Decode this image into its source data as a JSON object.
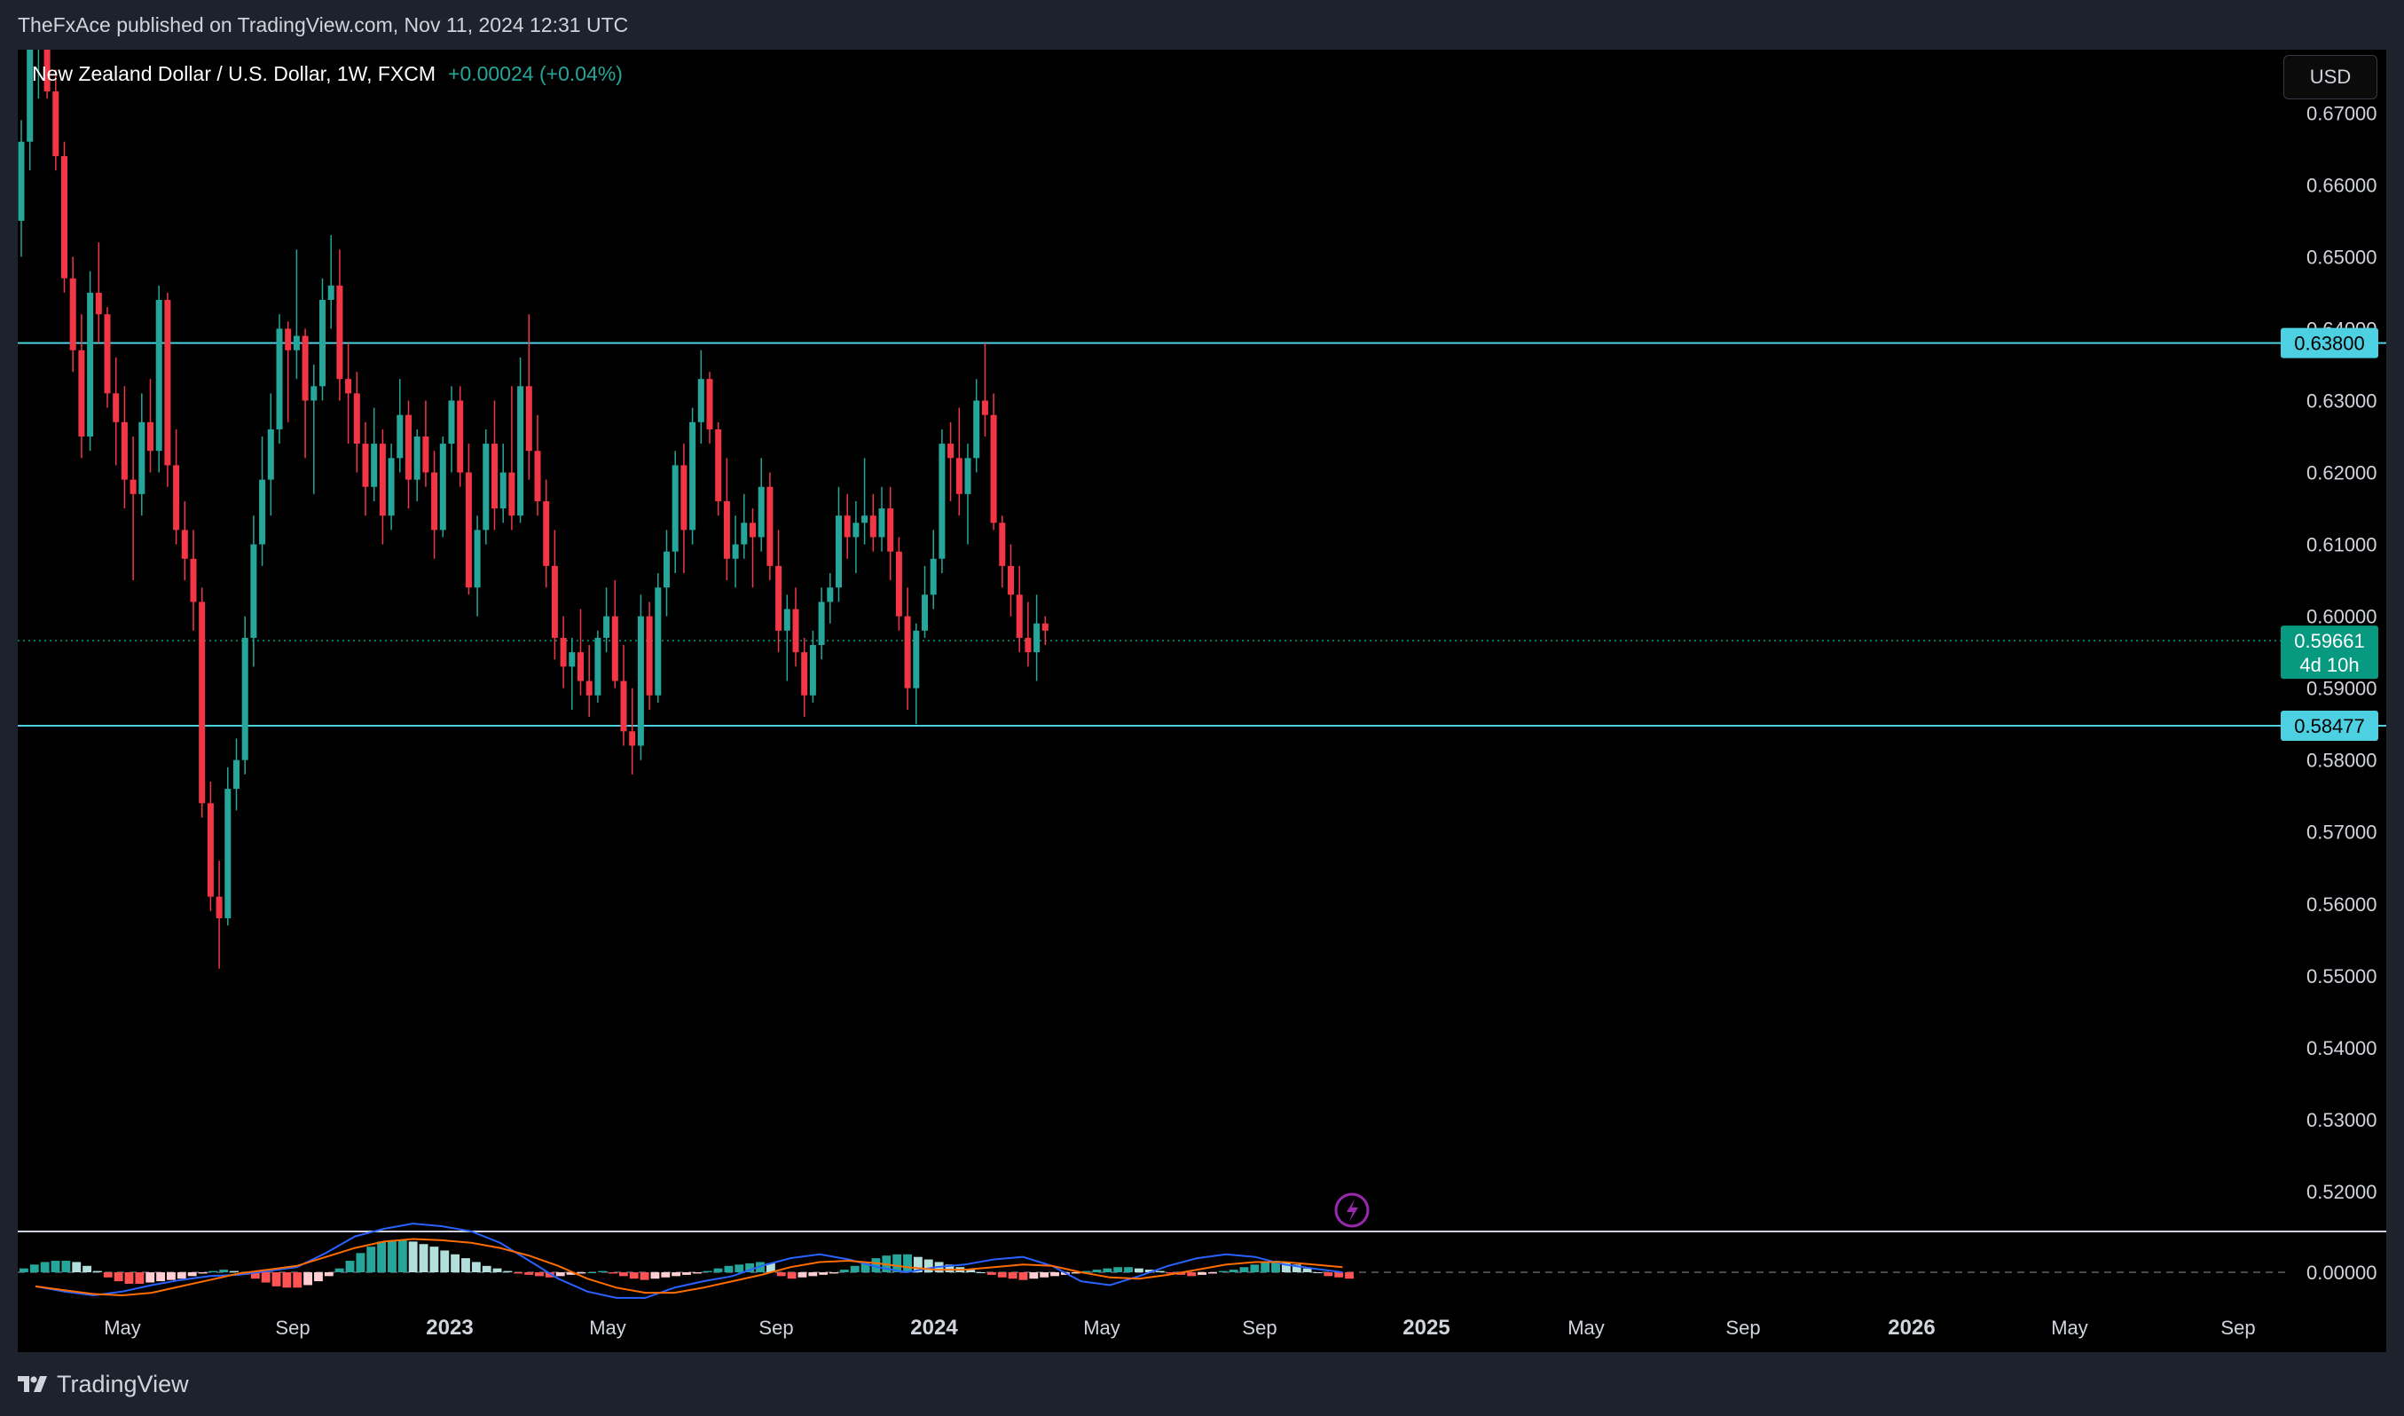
{
  "header": {
    "published_text": "TheFxAce published on TradingView.com, Nov 11, 2024 12:31 UTC"
  },
  "symbol": {
    "name": "New Zealand Dollar / U.S. Dollar, 1W, FXCM",
    "change": "+0.00024 (+0.04%)"
  },
  "currency_label": "USD",
  "footer": {
    "brand": "TradingView"
  },
  "colors": {
    "up": "#26a69a",
    "down": "#f23645",
    "level_line": "#4dd0e1",
    "level_label_bg": "#4dd0e1",
    "price_label_bg": "#089981",
    "macd_line": "#2962ff",
    "signal_line": "#ff6d00",
    "lightning": "#9c27b0"
  },
  "chart_data": {
    "type": "candlestick",
    "ylim": [
      0.5137,
      0.6788
    ],
    "y_ticks": [
      "0.67000",
      "0.66000",
      "0.65000",
      "0.64000",
      "0.63000",
      "0.62000",
      "0.61000",
      "0.60000",
      "0.59000",
      "0.58000",
      "0.57000",
      "0.56000",
      "0.55000",
      "0.54000",
      "0.53000",
      "0.52000"
    ],
    "x_ticks": [
      {
        "label": "May",
        "bold": false
      },
      {
        "label": "Sep",
        "bold": false
      },
      {
        "label": "2023",
        "bold": true
      },
      {
        "label": "May",
        "bold": false
      },
      {
        "label": "Sep",
        "bold": false
      },
      {
        "label": "2024",
        "bold": true
      },
      {
        "label": "May",
        "bold": false
      },
      {
        "label": "Sep",
        "bold": false
      },
      {
        "label": "2025",
        "bold": true
      },
      {
        "label": "May",
        "bold": false
      },
      {
        "label": "Sep",
        "bold": false
      },
      {
        "label": "2026",
        "bold": true
      },
      {
        "label": "May",
        "bold": false
      },
      {
        "label": "Sep",
        "bold": false
      }
    ],
    "horizontal_levels": [
      {
        "value": 0.638,
        "label": "0.63800"
      },
      {
        "value": 0.58477,
        "label": "0.58477"
      }
    ],
    "last_price": {
      "value": 0.59661,
      "label": "0.59661",
      "countdown": "4d 10h"
    },
    "candles": [
      [
        0.655,
        0.669,
        0.65,
        0.666
      ],
      [
        0.666,
        0.684,
        0.662,
        0.679
      ],
      [
        0.679,
        0.684,
        0.672,
        0.681
      ],
      [
        0.681,
        0.689,
        0.672,
        0.673
      ],
      [
        0.673,
        0.676,
        0.662,
        0.664
      ],
      [
        0.664,
        0.666,
        0.645,
        0.647
      ],
      [
        0.647,
        0.65,
        0.634,
        0.637
      ],
      [
        0.637,
        0.642,
        0.622,
        0.625
      ],
      [
        0.625,
        0.648,
        0.623,
        0.645
      ],
      [
        0.645,
        0.652,
        0.638,
        0.642
      ],
      [
        0.642,
        0.643,
        0.629,
        0.631
      ],
      [
        0.631,
        0.636,
        0.621,
        0.627
      ],
      [
        0.627,
        0.632,
        0.615,
        0.619
      ],
      [
        0.619,
        0.625,
        0.605,
        0.617
      ],
      [
        0.617,
        0.631,
        0.614,
        0.627
      ],
      [
        0.627,
        0.633,
        0.62,
        0.623
      ],
      [
        0.623,
        0.646,
        0.62,
        0.644
      ],
      [
        0.644,
        0.645,
        0.618,
        0.621
      ],
      [
        0.621,
        0.626,
        0.61,
        0.612
      ],
      [
        0.612,
        0.616,
        0.605,
        0.608
      ],
      [
        0.608,
        0.612,
        0.598,
        0.602
      ],
      [
        0.602,
        0.604,
        0.572,
        0.574
      ],
      [
        0.574,
        0.577,
        0.559,
        0.561
      ],
      [
        0.561,
        0.566,
        0.551,
        0.558
      ],
      [
        0.558,
        0.579,
        0.557,
        0.576
      ],
      [
        0.576,
        0.583,
        0.573,
        0.58
      ],
      [
        0.58,
        0.6,
        0.578,
        0.597
      ],
      [
        0.597,
        0.614,
        0.593,
        0.61
      ],
      [
        0.61,
        0.625,
        0.607,
        0.619
      ],
      [
        0.619,
        0.631,
        0.614,
        0.626
      ],
      [
        0.626,
        0.642,
        0.624,
        0.64
      ],
      [
        0.64,
        0.641,
        0.627,
        0.637
      ],
      [
        0.637,
        0.651,
        0.633,
        0.639
      ],
      [
        0.639,
        0.64,
        0.622,
        0.63
      ],
      [
        0.63,
        0.635,
        0.617,
        0.632
      ],
      [
        0.632,
        0.647,
        0.63,
        0.644
      ],
      [
        0.644,
        0.653,
        0.64,
        0.646
      ],
      [
        0.646,
        0.651,
        0.63,
        0.633
      ],
      [
        0.633,
        0.638,
        0.624,
        0.631
      ],
      [
        0.631,
        0.634,
        0.62,
        0.624
      ],
      [
        0.624,
        0.627,
        0.614,
        0.618
      ],
      [
        0.618,
        0.629,
        0.616,
        0.624
      ],
      [
        0.624,
        0.626,
        0.61,
        0.614
      ],
      [
        0.614,
        0.624,
        0.612,
        0.622
      ],
      [
        0.622,
        0.633,
        0.62,
        0.628
      ],
      [
        0.628,
        0.63,
        0.615,
        0.619
      ],
      [
        0.619,
        0.626,
        0.616,
        0.625
      ],
      [
        0.625,
        0.63,
        0.618,
        0.62
      ],
      [
        0.62,
        0.623,
        0.608,
        0.612
      ],
      [
        0.612,
        0.625,
        0.611,
        0.624
      ],
      [
        0.624,
        0.632,
        0.62,
        0.63
      ],
      [
        0.63,
        0.632,
        0.618,
        0.62
      ],
      [
        0.62,
        0.624,
        0.603,
        0.604
      ],
      [
        0.604,
        0.614,
        0.6,
        0.612
      ],
      [
        0.612,
        0.626,
        0.61,
        0.624
      ],
      [
        0.624,
        0.63,
        0.612,
        0.615
      ],
      [
        0.615,
        0.624,
        0.613,
        0.62
      ],
      [
        0.62,
        0.632,
        0.612,
        0.614
      ],
      [
        0.614,
        0.636,
        0.613,
        0.632
      ],
      [
        0.632,
        0.642,
        0.619,
        0.623
      ],
      [
        0.623,
        0.628,
        0.614,
        0.616
      ],
      [
        0.616,
        0.619,
        0.604,
        0.607
      ],
      [
        0.607,
        0.612,
        0.594,
        0.597
      ],
      [
        0.597,
        0.6,
        0.59,
        0.593
      ],
      [
        0.593,
        0.597,
        0.587,
        0.595
      ],
      [
        0.595,
        0.601,
        0.589,
        0.591
      ],
      [
        0.591,
        0.596,
        0.586,
        0.589
      ],
      [
        0.589,
        0.598,
        0.588,
        0.597
      ],
      [
        0.597,
        0.604,
        0.595,
        0.6
      ],
      [
        0.6,
        0.605,
        0.59,
        0.591
      ],
      [
        0.591,
        0.596,
        0.582,
        0.584
      ],
      [
        0.584,
        0.59,
        0.578,
        0.582
      ],
      [
        0.582,
        0.603,
        0.58,
        0.6
      ],
      [
        0.6,
        0.602,
        0.587,
        0.589
      ],
      [
        0.589,
        0.606,
        0.588,
        0.604
      ],
      [
        0.604,
        0.612,
        0.6,
        0.609
      ],
      [
        0.609,
        0.623,
        0.606,
        0.621
      ],
      [
        0.621,
        0.624,
        0.606,
        0.612
      ],
      [
        0.612,
        0.629,
        0.61,
        0.627
      ],
      [
        0.627,
        0.637,
        0.624,
        0.633
      ],
      [
        0.633,
        0.634,
        0.624,
        0.626
      ],
      [
        0.626,
        0.627,
        0.614,
        0.616
      ],
      [
        0.616,
        0.622,
        0.605,
        0.608
      ],
      [
        0.608,
        0.614,
        0.604,
        0.61
      ],
      [
        0.61,
        0.617,
        0.608,
        0.613
      ],
      [
        0.613,
        0.615,
        0.604,
        0.611
      ],
      [
        0.611,
        0.622,
        0.609,
        0.618
      ],
      [
        0.618,
        0.62,
        0.605,
        0.607
      ],
      [
        0.607,
        0.612,
        0.595,
        0.598
      ],
      [
        0.598,
        0.603,
        0.591,
        0.601
      ],
      [
        0.601,
        0.604,
        0.593,
        0.595
      ],
      [
        0.595,
        0.597,
        0.586,
        0.589
      ],
      [
        0.589,
        0.598,
        0.588,
        0.596
      ],
      [
        0.596,
        0.604,
        0.594,
        0.602
      ],
      [
        0.602,
        0.606,
        0.599,
        0.604
      ],
      [
        0.604,
        0.618,
        0.602,
        0.614
      ],
      [
        0.614,
        0.617,
        0.608,
        0.611
      ],
      [
        0.611,
        0.616,
        0.606,
        0.613
      ],
      [
        0.613,
        0.622,
        0.61,
        0.614
      ],
      [
        0.614,
        0.617,
        0.609,
        0.611
      ],
      [
        0.611,
        0.618,
        0.609,
        0.615
      ],
      [
        0.615,
        0.618,
        0.605,
        0.609
      ],
      [
        0.609,
        0.611,
        0.598,
        0.6
      ],
      [
        0.6,
        0.604,
        0.587,
        0.59
      ],
      [
        0.59,
        0.599,
        0.585,
        0.598
      ],
      [
        0.598,
        0.607,
        0.597,
        0.603
      ],
      [
        0.603,
        0.612,
        0.601,
        0.608
      ],
      [
        0.608,
        0.626,
        0.606,
        0.624
      ],
      [
        0.624,
        0.627,
        0.616,
        0.622
      ],
      [
        0.622,
        0.629,
        0.614,
        0.617
      ],
      [
        0.617,
        0.624,
        0.61,
        0.622
      ],
      [
        0.622,
        0.633,
        0.62,
        0.63
      ],
      [
        0.63,
        0.638,
        0.625,
        0.628
      ],
      [
        0.628,
        0.631,
        0.612,
        0.613
      ],
      [
        0.613,
        0.614,
        0.604,
        0.607
      ],
      [
        0.607,
        0.61,
        0.6,
        0.603
      ],
      [
        0.603,
        0.607,
        0.595,
        0.597
      ],
      [
        0.597,
        0.602,
        0.593,
        0.595
      ],
      [
        0.595,
        0.603,
        0.591,
        0.599
      ],
      [
        0.599,
        0.6,
        0.596,
        0.598
      ]
    ],
    "macd_histogram": [
      0.00076,
      0.00152,
      0.00202,
      0.00227,
      0.00227,
      0.00202,
      0.00126,
      0.00025,
      -0.00101,
      -0.00177,
      -0.00227,
      -0.00227,
      -0.00202,
      -0.00177,
      -0.00152,
      -0.00126,
      -0.00076,
      -0.00025,
      0.00025,
      0.0005,
      0.00025,
      -0.0005,
      -0.00126,
      -0.00202,
      -0.00278,
      -0.00303,
      -0.00303,
      -0.00253,
      -0.00177,
      -0.00076,
      0.00076,
      0.00227,
      0.00379,
      0.00505,
      0.00606,
      0.00631,
      0.00631,
      0.00606,
      0.00556,
      0.00505,
      0.0043,
      0.00354,
      0.00278,
      0.00202,
      0.00126,
      0.00076,
      0.00025,
      -0.00025,
      -0.0005,
      -0.00076,
      -0.00101,
      -0.00076,
      -0.0005,
      -0.00025,
      0.0,
      0.00025,
      -0.00025,
      -0.00076,
      -0.00126,
      -0.00151,
      -0.00126,
      -0.00101,
      -0.00076,
      -0.00051,
      -0.00025,
      0.00025,
      0.00076,
      0.00126,
      0.00152,
      0.00177,
      0.00202,
      0.00177,
      -0.00076,
      -0.00126,
      -0.00101,
      -0.00076,
      -0.0005,
      -0.00025,
      0.00051,
      0.00126,
      0.00202,
      0.00278,
      0.00329,
      0.00354,
      0.00354,
      0.00303,
      0.00253,
      0.00202,
      0.00152,
      0.00101,
      0.00051,
      0.0,
      -0.00051,
      -0.00101,
      -0.00126,
      -0.00152,
      -0.00126,
      -0.00101,
      -0.00076,
      -0.00051,
      -0.00025,
      0.00025,
      0.00051,
      0.00076,
      0.00101,
      0.00101,
      0.00076,
      0.00051,
      0.00025,
      -0.00025,
      -0.00051,
      -0.00076,
      -0.00051,
      -0.00025,
      0.00025,
      0.00051,
      0.00101,
      0.00152,
      0.00202,
      0.00227,
      0.00202,
      0.00152,
      0.00076,
      0.0,
      -0.00076,
      -0.00101,
      -0.00126
    ],
    "macd_line": [
      -0.00278,
      -0.00379,
      -0.00455,
      -0.00379,
      -0.00253,
      -0.00152,
      -0.00076,
      -0.0005,
      0.00025,
      0.00101,
      0.00379,
      0.00707,
      0.00858,
      0.0096,
      0.00909,
      0.00808,
      0.00581,
      0.00227,
      -0.00126,
      -0.00379,
      -0.00505,
      -0.00505,
      -0.00303,
      -0.00177,
      -0.00076,
      0.00126,
      0.00278,
      0.00354,
      0.00253,
      0.00101,
      0.0,
      0.00101,
      0.00152,
      0.00253,
      0.00303,
      0.00126,
      -0.00177,
      -0.00253,
      -0.00076,
      0.00126,
      0.00278,
      0.00354,
      0.00303,
      0.00152,
      0.00076,
      0.0
    ],
    "signal_line": [
      -0.00278,
      -0.00354,
      -0.00429,
      -0.00455,
      -0.00404,
      -0.00278,
      -0.00152,
      -0.00025,
      0.0005,
      0.00126,
      0.00303,
      0.0048,
      0.00606,
      0.00656,
      0.00631,
      0.00581,
      0.0048,
      0.00328,
      0.00126,
      -0.00126,
      -0.00303,
      -0.00404,
      -0.00404,
      -0.00303,
      -0.00177,
      -0.0005,
      0.00101,
      0.00202,
      0.00227,
      0.00177,
      0.00101,
      0.0005,
      0.0005,
      0.00101,
      0.00152,
      0.00126,
      0.0,
      -0.00101,
      -0.00126,
      -0.0005,
      0.0005,
      0.00152,
      0.00202,
      0.00202,
      0.00152,
      0.00101
    ]
  }
}
